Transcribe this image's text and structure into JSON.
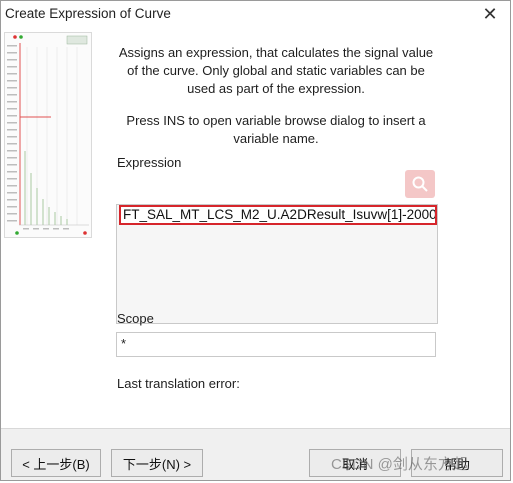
{
  "window": {
    "title": "Create Expression of Curve",
    "close_glyph": "✕"
  },
  "description": {
    "paragraph1_lines": [
      "Assigns an expression, that calculates the signal value",
      "of the curve.  Only global and static variables can be",
      "used as part of the expression."
    ],
    "paragraph2_lines": [
      "Press INS to open variable browse dialog to insert a",
      "variable name."
    ]
  },
  "expression": {
    "label": "Expression",
    "value": "FT_SAL_MT_LCS_M2_U.A2DResult_Isuvw[1]-2000"
  },
  "scope": {
    "label": "Scope",
    "value": "*"
  },
  "error": {
    "label": "Last translation error:"
  },
  "buttons": {
    "back": "< 上一步(B)",
    "next": "下一步(N) >",
    "cancel": "取消",
    "help": "帮助"
  },
  "watermark": "CSDN @剑从东方起",
  "icons": {
    "search": "search-icon",
    "close": "close-icon"
  },
  "colors": {
    "highlight_border": "#d6252b",
    "preview_line": "#e05050"
  }
}
